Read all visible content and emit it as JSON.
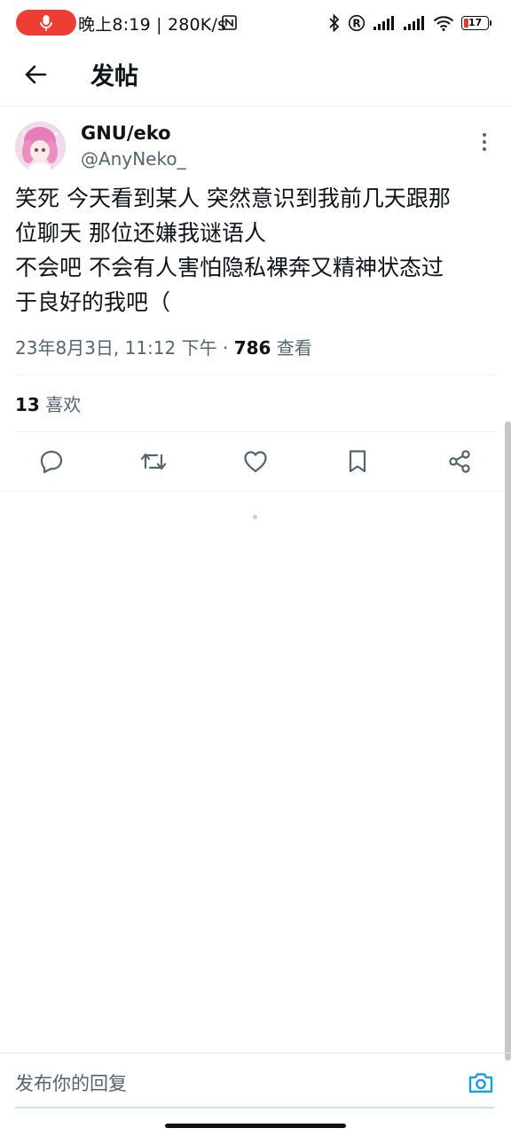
{
  "status_bar": {
    "time_speed": "晚上8:19 | 280K/s",
    "battery_level": "17",
    "icons": [
      "mic-icon",
      "nfc-icon",
      "bluetooth-icon",
      "registered-icon",
      "signal-icon",
      "signal-icon",
      "wifi-icon",
      "battery-icon"
    ]
  },
  "header": {
    "title": "发帖",
    "back_icon": "arrow-left-icon"
  },
  "tweet": {
    "display_name": "GNU/eko",
    "handle": "@AnyNeko_",
    "text_lines": [
      "笑死 今天看到某人 突然意识到我前几天跟那",
      "位聊天 那位还嫌我谜语人",
      "不会吧 不会有人害怕隐私裸奔又精神状态过",
      "于良好的我吧（"
    ],
    "date": "23年8月3日, 11:12 下午 · ",
    "views_count": "786",
    "views_label": " 查看",
    "likes_count": "13",
    "likes_label": " 喜欢"
  },
  "actions": [
    "reply-icon",
    "retweet-icon",
    "like-icon",
    "bookmark-icon",
    "share-icon"
  ],
  "reply": {
    "placeholder": "发布你的回复",
    "camera_icon": "camera-icon"
  },
  "colors": {
    "accent": "#1d9bf0",
    "text_primary": "#0f1419",
    "text_secondary": "#536471",
    "mic_pill": "#ee3e34",
    "battery_low": "#e53935"
  }
}
